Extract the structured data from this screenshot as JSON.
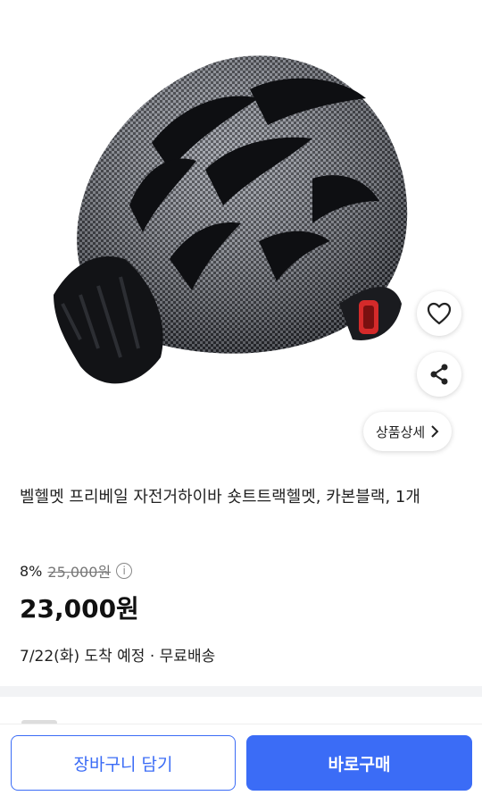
{
  "product": {
    "title": "벨헬멧 프리베일 자전거하이바 숏트트랙헬멧, 카본블랙, 1개",
    "discount": "8%",
    "original_price": "25,000원",
    "sale_price": "23,000원",
    "delivery": "7/22(화) 도착 예정 · 무료배송"
  },
  "image_actions": {
    "detail_label": "상품상세"
  },
  "bottom_bar": {
    "cart_label": "장바구니 담기",
    "buy_label": "바로구매"
  },
  "colors": {
    "accent": "#3b6cf6"
  }
}
